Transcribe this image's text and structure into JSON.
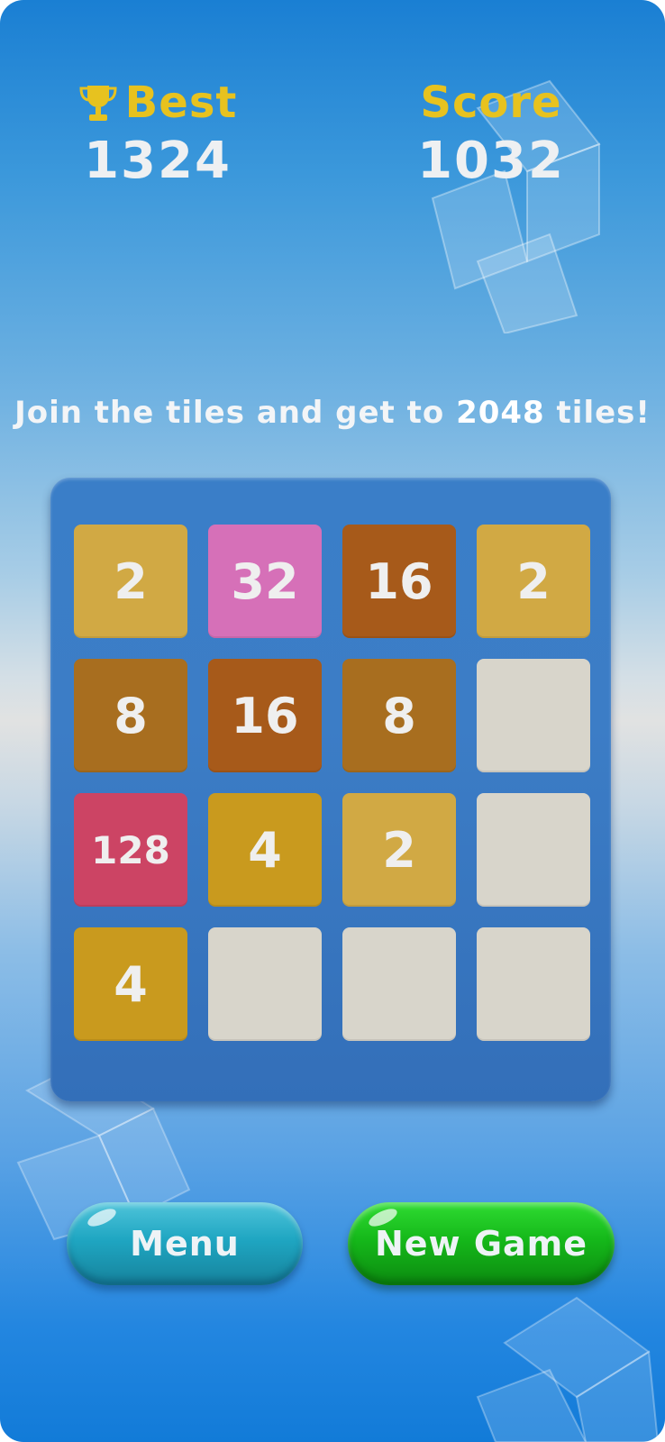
{
  "scores": {
    "best_label": "Best",
    "best_value": "1324",
    "score_label": "Score",
    "score_value": "1032",
    "trophy_icon": "trophy-icon"
  },
  "tagline": {
    "prefix": "Join the tiles and get to ",
    "target": "2048",
    "suffix": " tiles!"
  },
  "board": {
    "rows": [
      [
        {
          "value": "2",
          "color": "#d1a944"
        },
        {
          "value": "32",
          "color": "#d670b8"
        },
        {
          "value": "16",
          "color": "#a75a1a"
        },
        {
          "value": "2",
          "color": "#d1a944"
        }
      ],
      [
        {
          "value": "8",
          "color": "#a86e1f"
        },
        {
          "value": "16",
          "color": "#a75a1a"
        },
        {
          "value": "8",
          "color": "#a86e1f"
        },
        {
          "value": "",
          "color": "#d8d5cb"
        }
      ],
      [
        {
          "value": "128",
          "color": "#cc4464"
        },
        {
          "value": "4",
          "color": "#c99a1e"
        },
        {
          "value": "2",
          "color": "#d1a944"
        },
        {
          "value": "",
          "color": "#d8d5cb"
        }
      ],
      [
        {
          "value": "4",
          "color": "#c99a1e"
        },
        {
          "value": "",
          "color": "#d8d5cb"
        },
        {
          "value": "",
          "color": "#d8d5cb"
        },
        {
          "value": "",
          "color": "#d8d5cb"
        }
      ]
    ]
  },
  "buttons": {
    "menu_label": "Menu",
    "new_game_label": "New Game"
  },
  "colors": {
    "accent_gold": "#e7c21f",
    "board_blue": "#3a7ec8",
    "menu_teal": "#1fa6c2",
    "new_game_green": "#15b81a"
  }
}
